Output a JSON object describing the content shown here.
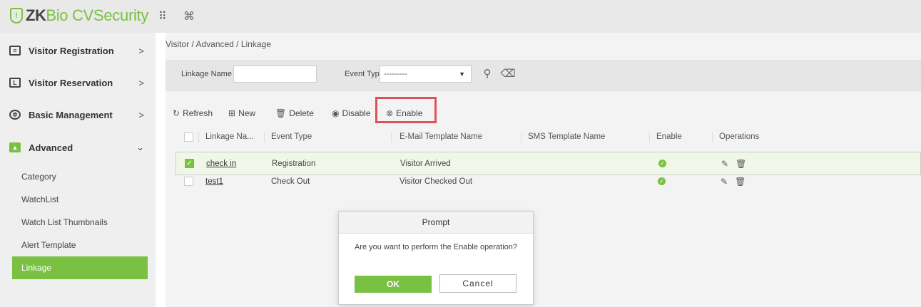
{
  "header": {
    "logo_mark": "!",
    "logo_zk": "ZK",
    "logo_rest": "Bio CVSecurity",
    "icons": [
      "grid-icon",
      "command-icon"
    ],
    "grid_glyph": "⠿",
    "command_glyph": "⌘"
  },
  "sidebar": {
    "menus": [
      {
        "label": "Visitor Registration",
        "icon": "registration-icon",
        "chevron": ">"
      },
      {
        "label": "Visitor Reservation",
        "icon": "reservation-icon",
        "chevron": ">"
      },
      {
        "label": "Basic Management",
        "icon": "gears-icon",
        "chevron": ">"
      },
      {
        "label": "Advanced",
        "icon": "advanced-icon",
        "chevron": "⌄"
      }
    ],
    "sub_items": [
      "Category",
      "WatchList",
      "Watch List Thumbnails",
      "Alert Template",
      "Linkage"
    ],
    "active_sub": "Linkage",
    "accent": "#7ac143"
  },
  "breadcrumb": "Visitor / Advanced / Linkage",
  "search": {
    "linkage_name_label": "Linkage Name",
    "linkage_name_value": "",
    "event_type_label": "Event Type",
    "event_type_value": "---------"
  },
  "toolbar": {
    "refresh": "Refresh",
    "new": "New",
    "delete": "Delete",
    "disable": "Disable",
    "enable": "Enable",
    "highlight_color": "#e0505a"
  },
  "table": {
    "columns": [
      "Linkage Na...",
      "Event Type",
      "E-Mail Template Name",
      "SMS Template Name",
      "Enable",
      "Operations"
    ],
    "rows": [
      {
        "name": "check in",
        "event_type": "Registration",
        "email_template": "Visitor Arrived",
        "sms_template": "",
        "enabled": true,
        "checked": true
      },
      {
        "name": "test1",
        "event_type": "Check Out",
        "email_template": "Visitor Checked Out",
        "sms_template": "",
        "enabled": true,
        "checked": false
      }
    ]
  },
  "modal": {
    "title": "Prompt",
    "message": "Are you want to perform the Enable operation?",
    "ok": "OK",
    "cancel": "Cancel"
  }
}
